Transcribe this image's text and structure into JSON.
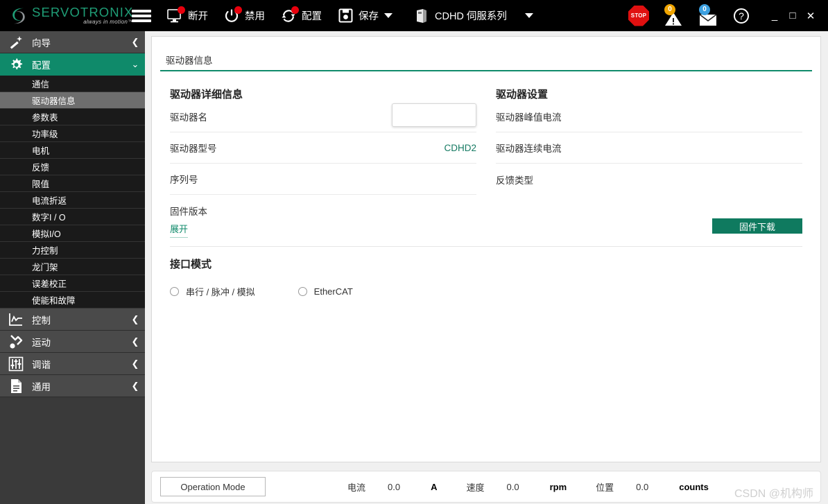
{
  "app": {
    "logo_name": "SERVOTRONIX",
    "logo_tagline": "always in motion™"
  },
  "toolbar": {
    "menu_icon": "hamburger-menu-icon",
    "items": [
      {
        "icon": "monitor-icon",
        "label": "断开",
        "badge": true
      },
      {
        "icon": "power-icon",
        "label": "禁用",
        "badge": true
      },
      {
        "icon": "refresh-icon",
        "label": "配置",
        "badge": true
      },
      {
        "icon": "save-icon",
        "label": "保存",
        "badge": false,
        "caret": true
      }
    ],
    "device_icon": "drive-icon",
    "device_label": "CDHD 伺服系列",
    "stop_label": "STOP",
    "warning_count": "0",
    "mail_count": "0",
    "help_label": "?",
    "window_minimize": "_",
    "window_maximize": "□",
    "window_close": "✕"
  },
  "sidebar": {
    "groups": [
      {
        "icon": "wand-icon",
        "label": "向导",
        "chevron": "❮",
        "state": "collapsed"
      },
      {
        "icon": "gear-icon",
        "label": "配置",
        "chevron": "⌄",
        "state": "expanded"
      }
    ],
    "config_items": [
      {
        "label": "通信",
        "selected": false
      },
      {
        "label": "驱动器信息",
        "selected": true
      },
      {
        "label": "参数表",
        "selected": false
      },
      {
        "label": "功率级",
        "selected": false
      },
      {
        "label": "电机",
        "selected": false
      },
      {
        "label": "反馈",
        "selected": false
      },
      {
        "label": "限值",
        "selected": false
      },
      {
        "label": "电流折返",
        "selected": false
      },
      {
        "label": "数字I / O",
        "selected": false
      },
      {
        "label": "模拟I/O",
        "selected": false
      },
      {
        "label": "力控制",
        "selected": false
      },
      {
        "label": "龙门架",
        "selected": false
      },
      {
        "label": "误差校正",
        "selected": false
      },
      {
        "label": "使能和故障",
        "selected": false
      }
    ],
    "bottom_groups": [
      {
        "icon": "chart-icon",
        "label": "控制",
        "chevron": "❮"
      },
      {
        "icon": "robot-arm-icon",
        "label": "运动",
        "chevron": "❮"
      },
      {
        "icon": "sliders-icon",
        "label": "调谐",
        "chevron": "❮"
      },
      {
        "icon": "document-icon",
        "label": "通用",
        "chevron": "❮"
      }
    ]
  },
  "main": {
    "tab_title": "驱动器信息",
    "left_section_title": "驱动器详细信息",
    "left_fields": [
      {
        "label": "驱动器名",
        "value": "",
        "input": true,
        "input_value": ""
      },
      {
        "label": "驱动器型号",
        "value": "CDHD2",
        "input": false
      },
      {
        "label": "序列号",
        "value": "",
        "input": false
      },
      {
        "label": "固件版本",
        "value": "",
        "input": false
      }
    ],
    "right_section_title": "驱动器设置",
    "right_fields": [
      {
        "label": "驱动器峰值电流",
        "value": ""
      },
      {
        "label": "驱动器连续电流",
        "value": ""
      },
      {
        "label": "反馈类型",
        "value": ""
      }
    ],
    "expand_label": "展开",
    "firmware_button": "固件下载",
    "interface_title": "接口模式",
    "interface_options": [
      {
        "label": "串行 / 脉冲 / 模拟",
        "selected": false
      },
      {
        "label": "EtherCAT",
        "selected": false
      }
    ]
  },
  "status": {
    "operation_mode": "Operation Mode",
    "readouts": [
      {
        "key": "电流",
        "value": "0.0",
        "unit": "A"
      },
      {
        "key": "速度",
        "value": "0.0",
        "unit": "rpm"
      },
      {
        "key": "位置",
        "value": "0.0",
        "unit": "counts"
      }
    ],
    "watermark": "CSDN @机构师"
  },
  "colors": {
    "accent_teal": "#0f8a6a",
    "button_teal": "#0f7a5f",
    "value_teal": "#157a62",
    "topbar_black": "#000000",
    "sidebar_dark": "#1a1a1a",
    "sidebar_group": "#4a4a4a",
    "selected_gray": "#6e6e6e",
    "stop_red": "#e01010",
    "badge_orange": "#f0a500",
    "badge_blue": "#3ca0e0"
  }
}
